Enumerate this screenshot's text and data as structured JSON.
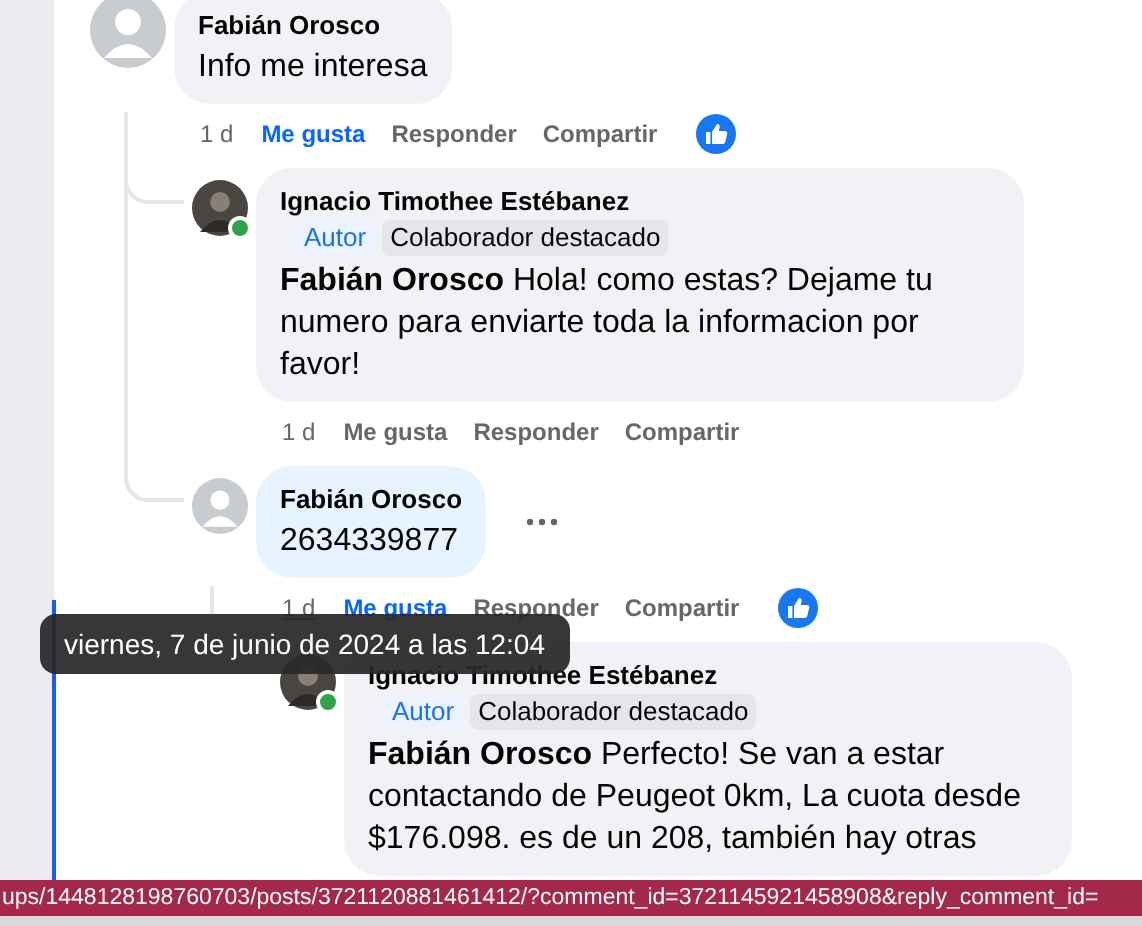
{
  "comments": [
    {
      "author": "Fabián Orosco",
      "avatar": {
        "kind": "placeholder"
      },
      "online": false,
      "text": "Info me interesa",
      "has_more_button": false,
      "actions": {
        "time": "1 d",
        "time_hovered": false,
        "liked": true,
        "like": "Me gusta",
        "reply": "Responder",
        "share": "Compartir",
        "has_reaction": true
      },
      "children": [
        {
          "author": "Ignacio Timothee Estébanez",
          "avatar": {
            "kind": "photo"
          },
          "online": true,
          "badges": [
            {
              "label": "Autor",
              "kind": "author"
            },
            {
              "label": "Colaborador destacado",
              "kind": "top"
            }
          ],
          "text": "**Fabián Orosco** Hola! como estas? Dejame tu numero para enviarte toda la informacion por favor!",
          "has_more_button": false,
          "actions": {
            "time": "1 d",
            "time_hovered": false,
            "liked": false,
            "like": "Me gusta",
            "reply": "Responder",
            "share": "Compartir",
            "has_reaction": false
          }
        },
        {
          "author": "Fabián Orosco",
          "avatar": {
            "kind": "placeholder"
          },
          "online": false,
          "text": "2634339877",
          "has_more_button": true,
          "actions": {
            "time": "1 d",
            "time_hovered": true,
            "liked": true,
            "like": "Me gusta",
            "reply": "Responder",
            "share": "Compartir",
            "has_reaction": true
          },
          "children": [
            {
              "author": "Ignacio Timothee Estébanez",
              "avatar": {
                "kind": "photo"
              },
              "online": true,
              "badges": [
                {
                  "label": "Autor",
                  "kind": "author"
                },
                {
                  "label": "Colaborador destacado",
                  "kind": "top"
                }
              ],
              "text": "**Fabián Orosco** Perfecto! Se van a estar contactando de Peugeot 0km, La cuota desde $176.098. es de un 208, también hay otras",
              "has_more_button": false
            }
          ]
        }
      ]
    }
  ],
  "tooltip": "viernes, 7 de junio de 2024 a las 12:04",
  "status_bar": "ups/1448128198760703/posts/3721120881461412/?comment_id=3721145921458908&reply_comment_id="
}
